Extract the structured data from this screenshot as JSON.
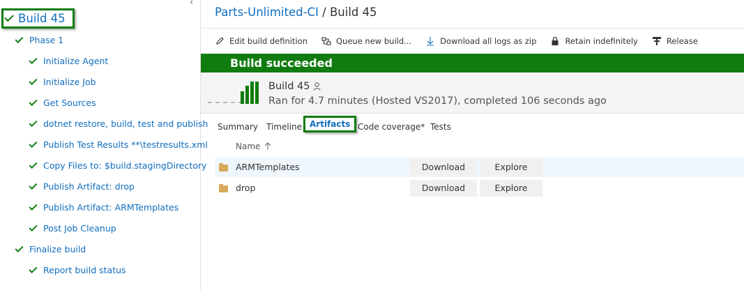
{
  "colors": {
    "success_green": "#107c10",
    "link_blue": "#106ebe",
    "selected_row": "#eff6fc",
    "folder": "#d8a95a"
  },
  "left_panel": {
    "collapse_icon": "chevron-left-icon",
    "build_root": "Build 45",
    "items": [
      {
        "label": "Phase 1"
      },
      {
        "label": "Initialize Agent"
      },
      {
        "label": "Initialize Job"
      },
      {
        "label": "Get Sources"
      },
      {
        "label": "dotnet restore, build, test and publish"
      },
      {
        "label": "Publish Test Results **\\testresults.xml"
      },
      {
        "label": "Copy Files to: $build.stagingDirectory"
      },
      {
        "label": "Publish Artifact: drop"
      },
      {
        "label": "Publish Artifact: ARMTemplates"
      },
      {
        "label": "Post Job Cleanup"
      },
      {
        "label": "Finalize build"
      },
      {
        "label": "Report build status"
      }
    ]
  },
  "breadcrumb": {
    "project": "Parts-Unlimited-CI",
    "separator": " / ",
    "build": "Build 45"
  },
  "toolbar": {
    "edit": "Edit build definition",
    "queue": "Queue new build...",
    "download_logs": "Download all logs as zip",
    "retain": "Retain indefinitely",
    "release": "Release"
  },
  "banner": {
    "status": "Build succeeded"
  },
  "summary": {
    "title": "Build 45",
    "subtitle": "Ran for 4.7 minutes (Hosted VS2017), completed 106 seconds ago"
  },
  "tabs": {
    "summary": "Summary",
    "timeline": "Timeline",
    "artifacts": "Artifacts",
    "coverage": "Code coverage*",
    "tests": "Tests"
  },
  "artifacts": {
    "column_name": "Name",
    "rows": [
      {
        "name": "ARMTemplates",
        "download": "Download",
        "explore": "Explore"
      },
      {
        "name": "drop",
        "download": "Download",
        "explore": "Explore"
      }
    ]
  }
}
